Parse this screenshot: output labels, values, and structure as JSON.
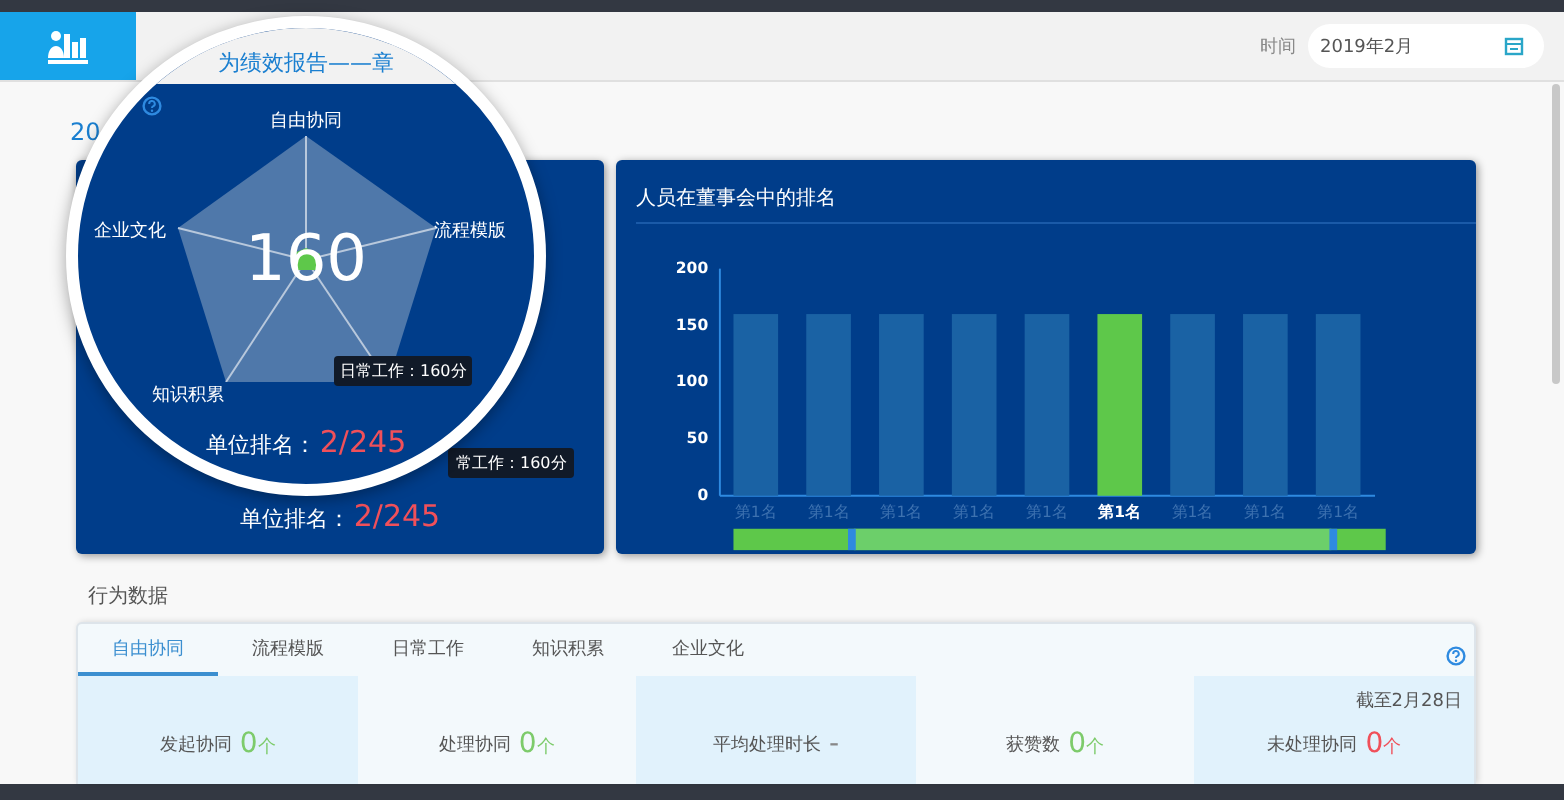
{
  "header": {
    "time_label": "时间",
    "date_value": "2019年2月"
  },
  "year_label": "20",
  "radar_card": {
    "visible_tooltip": "常工作：160分",
    "rank_label": "单位排名：",
    "rank_value": "2/245"
  },
  "magnifier": {
    "title": "为绩效报告——章",
    "score": "160",
    "axes": [
      "自由协同",
      "流程模版",
      "知识积累",
      "企业文化"
    ],
    "tooltip": "日常工作：160分",
    "rank_label": "单位排名：",
    "rank_value": "2/245"
  },
  "ranking_card": {
    "title": "人员在董事会中的排名",
    "chart_data": {
      "type": "bar",
      "categories": [
        "第1名",
        "第1名",
        "第1名",
        "第1名",
        "第1名",
        "第1名",
        "第1名",
        "第1名",
        "第1名"
      ],
      "series": [
        {
          "color": "#1a62a4",
          "colors": [
            "#1a62a4",
            "#1a62a4",
            "#1a62a4",
            "#1a62a4",
            "#1a62a4",
            "#5ec84a",
            "#1a62a4",
            "#1a62a4",
            "#1a62a4"
          ],
          "values": [
            160,
            160,
            160,
            160,
            160,
            160,
            160,
            160,
            160
          ]
        }
      ],
      "ylim": [
        0,
        200
      ],
      "yticks": [
        0,
        50,
        100,
        150,
        200
      ]
    }
  },
  "behavior": {
    "title": "行为数据",
    "tabs": [
      {
        "label": "自由协同",
        "selected": true
      },
      {
        "label": "流程模版",
        "selected": false
      },
      {
        "label": "日常工作",
        "selected": false
      },
      {
        "label": "知识积累",
        "selected": false
      },
      {
        "label": "企业文化",
        "selected": false
      }
    ],
    "stats": [
      {
        "label": "发起协同",
        "value": "0",
        "unit": "个",
        "color": "#7dcb6b"
      },
      {
        "label": "处理协同",
        "value": "0",
        "unit": "个",
        "color": "#7dcb6b"
      },
      {
        "label": "平均处理时长",
        "value": "-",
        "color": "#888888"
      },
      {
        "label": "获赞数",
        "value": "0",
        "unit": "个",
        "color": "#7dcb6b"
      },
      {
        "label": "未处理协同",
        "value": "0",
        "unit": "个",
        "color": "#f0505a",
        "note": "截至2月28日"
      }
    ]
  }
}
